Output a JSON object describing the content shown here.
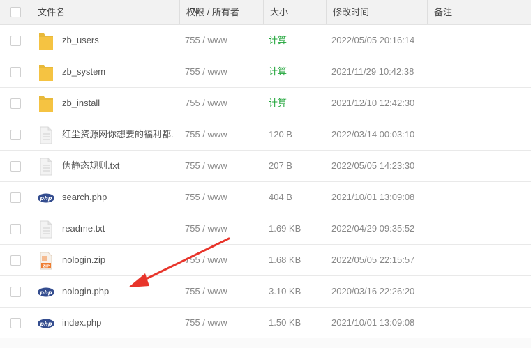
{
  "header": {
    "name": "文件名",
    "perm": "权限 / 所有者",
    "size": "大小",
    "mtime": "修改时间",
    "note": "备注"
  },
  "colors": {
    "calc": "#20a53a",
    "folder": "#f5c342",
    "php": "#344d8f",
    "arrow": "#e8352b"
  },
  "rows": [
    {
      "icon": "folder-icon",
      "name": "zb_users",
      "perm": "755 / www",
      "size": "计算",
      "mtime": "2022/05/05 20:16:14"
    },
    {
      "icon": "folder-icon",
      "name": "zb_system",
      "perm": "755 / www",
      "size": "计算",
      "mtime": "2021/11/29 10:42:38"
    },
    {
      "icon": "folder-icon",
      "name": "zb_install",
      "perm": "755 / www",
      "size": "计算",
      "mtime": "2021/12/10 12:42:30"
    },
    {
      "icon": "text-file-icon",
      "name": "红尘资源网你想要的福利都...",
      "perm": "755 / www",
      "size": "120 B",
      "mtime": "2022/03/14 00:03:10"
    },
    {
      "icon": "text-file-icon",
      "name": "伪静态规则.txt",
      "perm": "755 / www",
      "size": "207 B",
      "mtime": "2022/05/05 14:23:30"
    },
    {
      "icon": "php-icon",
      "name": "search.php",
      "perm": "755 / www",
      "size": "404 B",
      "mtime": "2021/10/01 13:09:08"
    },
    {
      "icon": "text-file-icon",
      "name": "readme.txt",
      "perm": "755 / www",
      "size": "1.69 KB",
      "mtime": "2022/04/29 09:35:52"
    },
    {
      "icon": "zip-icon",
      "name": "nologin.zip",
      "perm": "755 / www",
      "size": "1.68 KB",
      "mtime": "2022/05/05 22:15:57"
    },
    {
      "icon": "php-icon",
      "name": "nologin.php",
      "perm": "755 / www",
      "size": "3.10 KB",
      "mtime": "2020/03/16 22:26:20"
    },
    {
      "icon": "php-icon",
      "name": "index.php",
      "perm": "755 / www",
      "size": "1.50 KB",
      "mtime": "2021/10/01 13:09:08"
    }
  ],
  "php_label": "php",
  "zip_label": "ZIP"
}
